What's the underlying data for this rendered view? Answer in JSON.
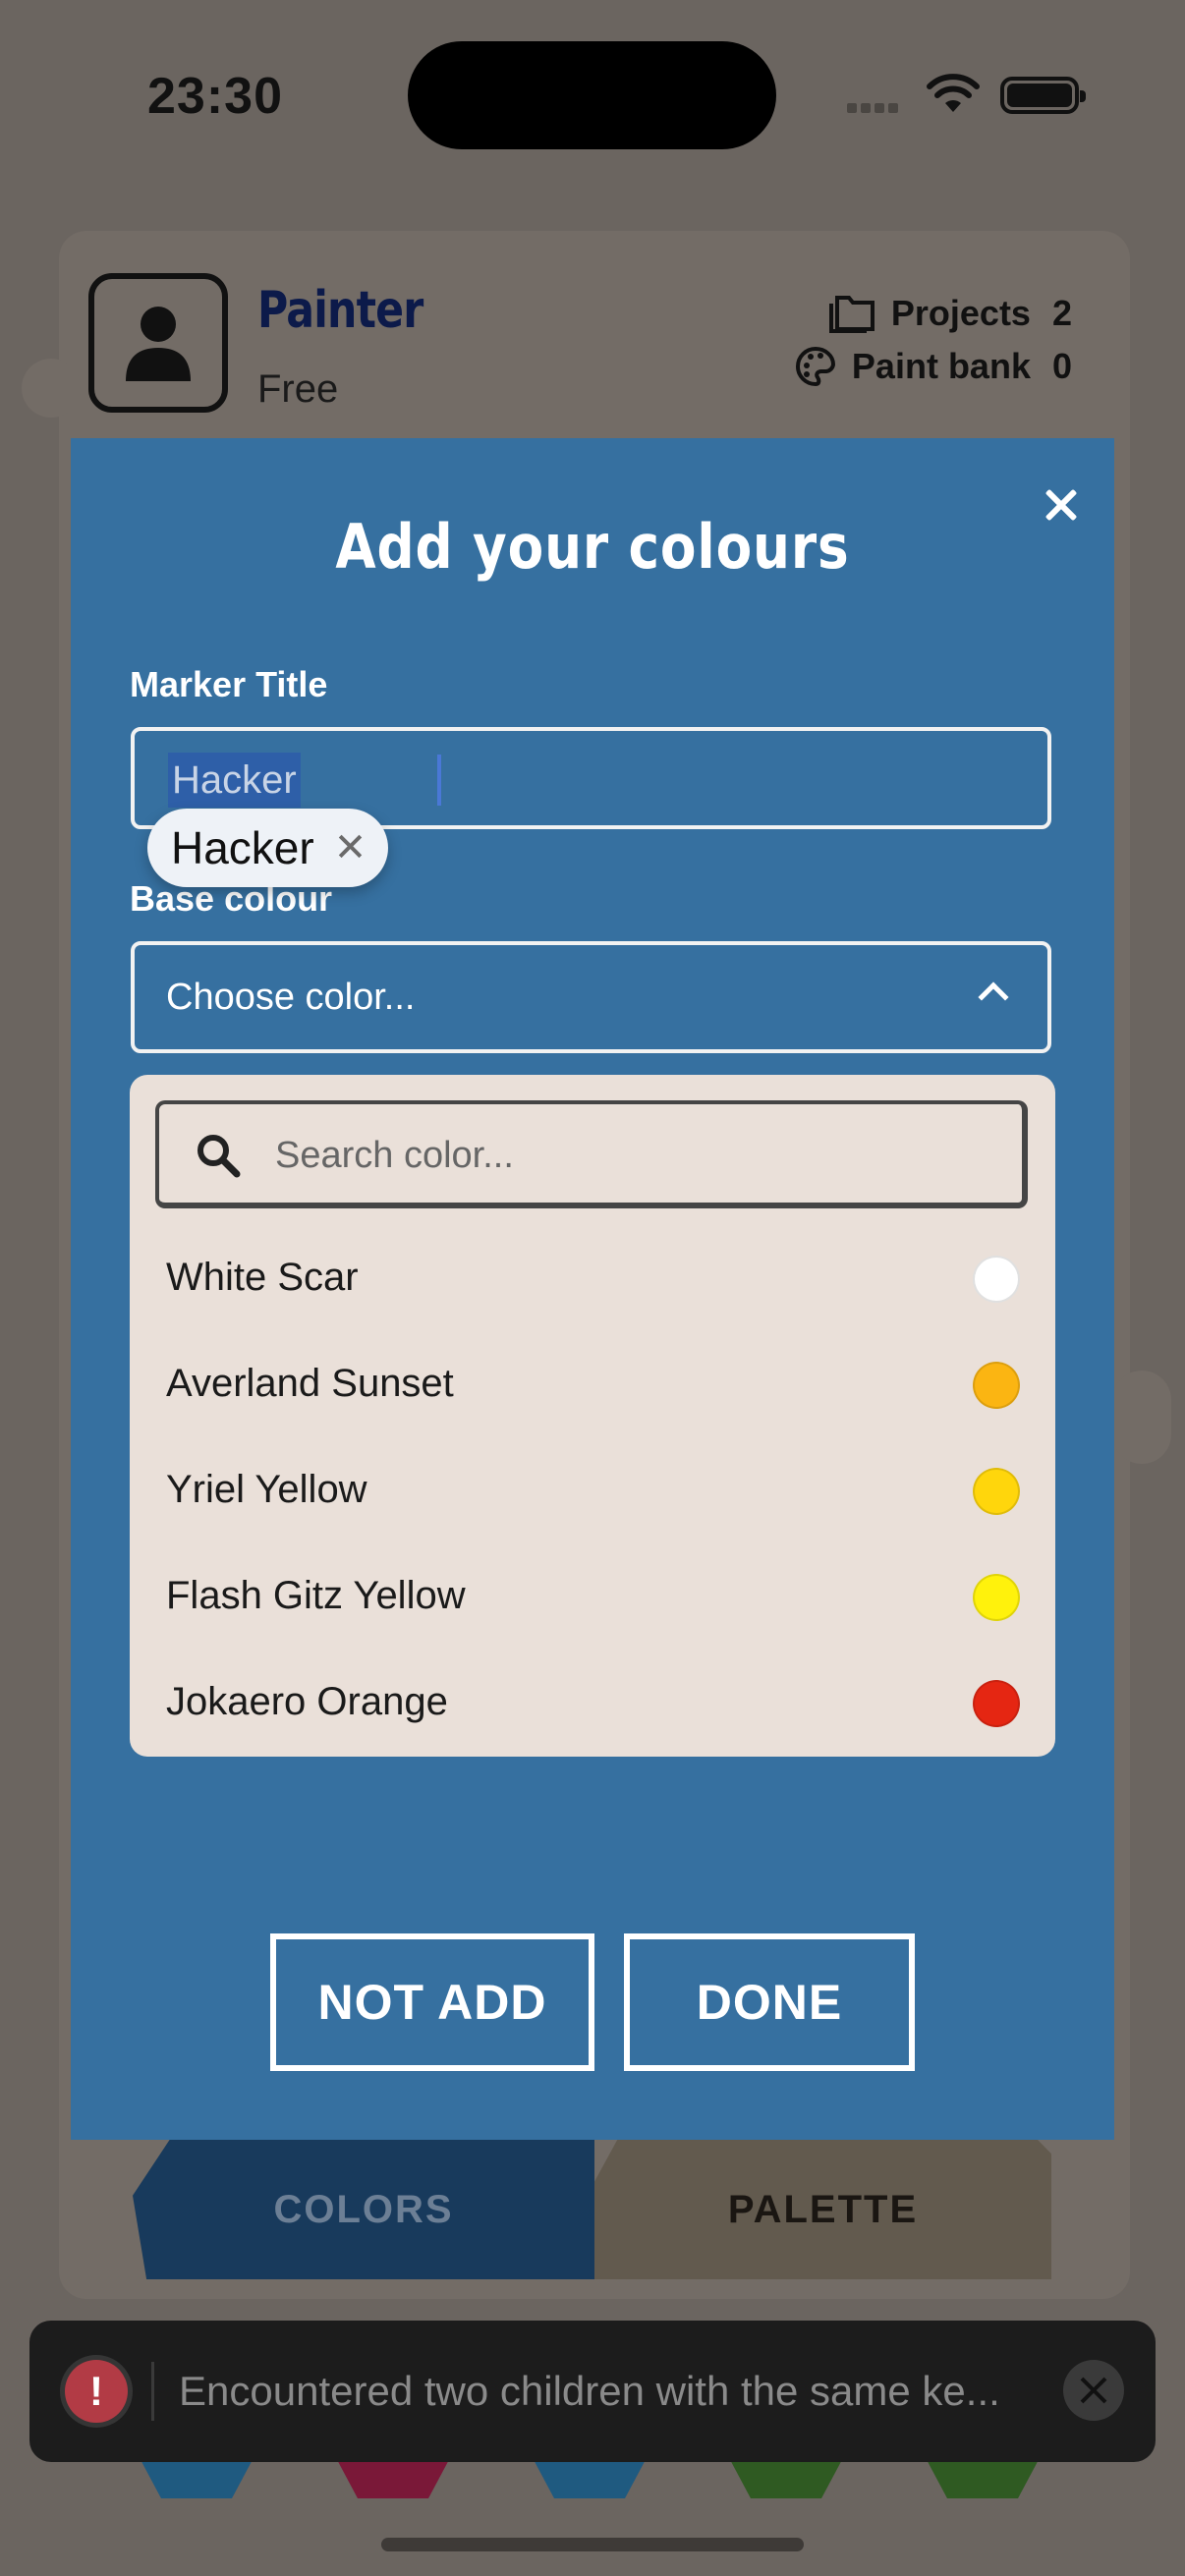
{
  "status_bar": {
    "time": "23:30",
    "icons": [
      "signal-icon",
      "wifi-icon",
      "battery-icon"
    ]
  },
  "profile": {
    "name": "Painter",
    "plan": "Free",
    "stats": [
      {
        "label": "Projects",
        "value": "2",
        "icon": "folder-icon"
      },
      {
        "label": "Paint bank",
        "value": "0",
        "icon": "palette-icon"
      }
    ]
  },
  "tabs": {
    "colors": "COLORS",
    "palette": "PALETTE"
  },
  "modal": {
    "title": "Add your colours",
    "marker_title_label": "Marker Title",
    "marker_title_value": "Hacker",
    "autocomplete_chip": "Hacker",
    "base_colour_label": "Base colour",
    "base_colour_placeholder": "Choose color...",
    "search_placeholder": "Search color...",
    "options": [
      {
        "label": "White Scar",
        "color": "#ffffff"
      },
      {
        "label": "Averland Sunset",
        "color": "#fbb512"
      },
      {
        "label": "Yriel Yellow",
        "color": "#ffd60c"
      },
      {
        "label": "Flash Gitz Yellow",
        "color": "#fff20c"
      },
      {
        "label": "Jokaero Orange",
        "color": "#e52612"
      }
    ],
    "not_add_label": "NOT ADD",
    "done_label": "DONE"
  },
  "toast": {
    "message": "Encountered two children with the same ke..."
  },
  "colors": {
    "modal_bg": "#3670a0",
    "dropdown_bg": "#eae0d9",
    "page_bg": "#6b6560"
  }
}
